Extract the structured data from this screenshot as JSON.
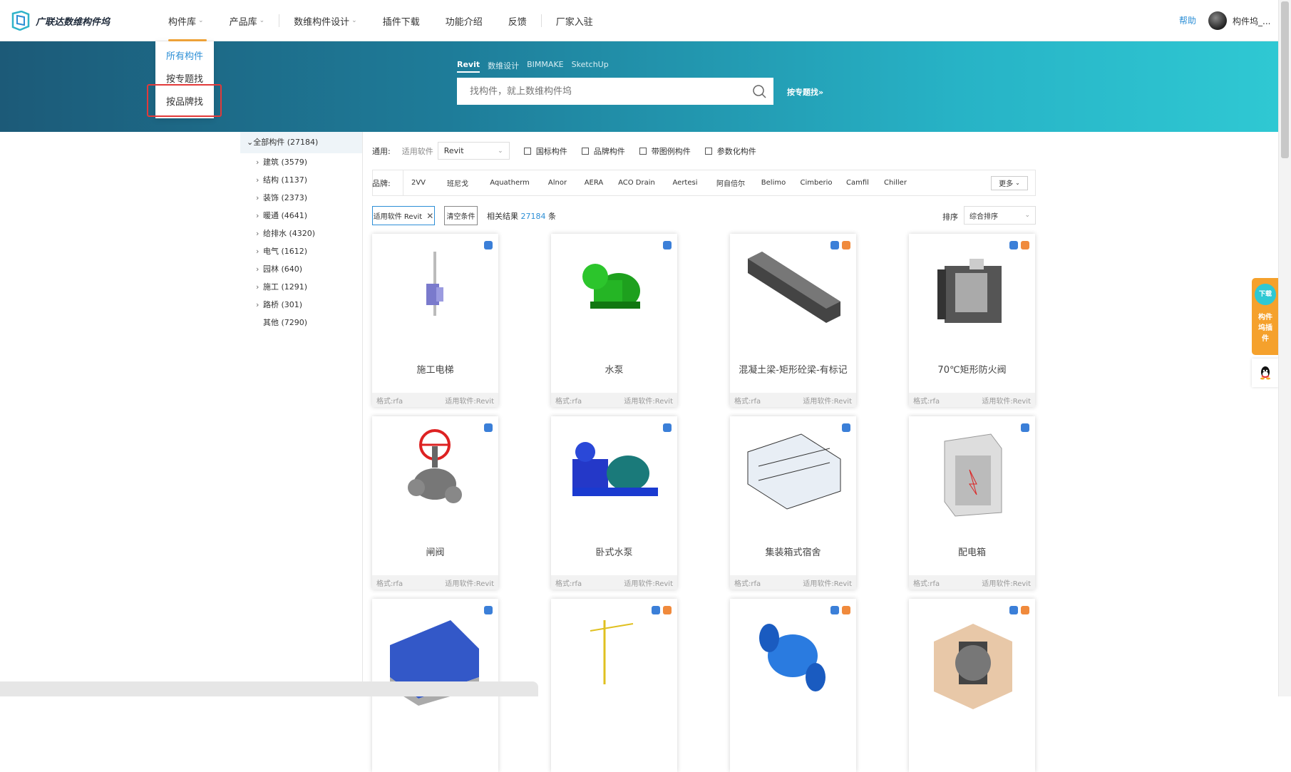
{
  "logo": {
    "text": "广联达数维构件坞"
  },
  "nav": [
    {
      "label": "构件库",
      "has_dropdown": true
    },
    {
      "label": "产品库",
      "has_dropdown": true
    },
    {
      "label": "数维构件设计",
      "has_dropdown": true
    },
    {
      "label": "插件下载",
      "has_dropdown": false
    },
    {
      "label": "功能介绍",
      "has_dropdown": false
    },
    {
      "label": "反馈",
      "has_dropdown": false
    },
    {
      "label": "厂家入驻",
      "has_dropdown": false
    }
  ],
  "header": {
    "help": "帮助",
    "username": "构件坞_..."
  },
  "dropdown": {
    "items": [
      "所有构件",
      "按专题找",
      "按品牌找"
    ],
    "selected": "所有构件",
    "highlighted": "按品牌找"
  },
  "search": {
    "tabs": [
      "Revit",
      "数维设计",
      "BIMMAKE",
      "SketchUp"
    ],
    "active_tab": "Revit",
    "placeholder": "找构件，就上数维构件坞",
    "topic_link": "按专题找»"
  },
  "sidebar": {
    "root": "全部构件 (27184)",
    "items": [
      {
        "label": "建筑 (3579)",
        "expandable": true
      },
      {
        "label": "结构 (1137)",
        "expandable": true
      },
      {
        "label": "装饰 (2373)",
        "expandable": true
      },
      {
        "label": "暖通 (4641)",
        "expandable": true
      },
      {
        "label": "给排水 (4320)",
        "expandable": true
      },
      {
        "label": "电气 (1612)",
        "expandable": true
      },
      {
        "label": "园林 (640)",
        "expandable": true
      },
      {
        "label": "施工 (1291)",
        "expandable": true
      },
      {
        "label": "路桥 (301)",
        "expandable": true
      },
      {
        "label": "其他 (7290)",
        "expandable": false
      }
    ]
  },
  "filters": {
    "general_label": "通用:",
    "software_label": "适用软件",
    "software_value": "Revit",
    "checkboxes": [
      "国标构件",
      "品牌构件",
      "带图例构件",
      "参数化构件"
    ],
    "brand_label": "品牌:",
    "brands": [
      "2VV",
      "班尼戈",
      "Aquatherm",
      "Alnor",
      "AERA",
      "ACO Drain",
      "Aertesi",
      "阿自倍尔",
      "Belimo",
      "Cimberio",
      "Camfil",
      "Chiller"
    ],
    "more": "更多"
  },
  "active_tag": "适用软件 Revit",
  "clear_label": "清空条件",
  "result": {
    "prefix": "相关结果",
    "count": "27184",
    "suffix": "条"
  },
  "sort": {
    "label": "排序",
    "value": "综合排序"
  },
  "cards": [
    {
      "name": "施工电梯",
      "format": "格式:rfa",
      "software": "适用软件:Revit",
      "badges": [
        "blue"
      ]
    },
    {
      "name": "水泵",
      "format": "格式:rfa",
      "software": "适用软件:Revit",
      "badges": [
        "blue"
      ]
    },
    {
      "name": "混凝土梁-矩形砼梁-有标记",
      "format": "格式:rfa",
      "software": "适用软件:Revit",
      "badges": [
        "blue",
        "orange"
      ]
    },
    {
      "name": "70℃矩形防火阀",
      "format": "格式:rfa",
      "software": "适用软件:Revit",
      "badges": [
        "blue",
        "orange"
      ]
    },
    {
      "name": "闸阀",
      "format": "格式:rfa",
      "software": "适用软件:Revit",
      "badges": [
        "blue"
      ]
    },
    {
      "name": "卧式水泵",
      "format": "格式:rfa",
      "software": "适用软件:Revit",
      "badges": [
        "blue"
      ]
    },
    {
      "name": "集装箱式宿舍",
      "format": "格式:rfa",
      "software": "适用软件:Revit",
      "badges": [
        "blue"
      ]
    },
    {
      "name": "配电箱",
      "format": "格式:rfa",
      "software": "适用软件:Revit",
      "badges": [
        "blue"
      ]
    },
    {
      "name": "",
      "format": "",
      "software": "",
      "badges": [
        "blue"
      ]
    },
    {
      "name": "",
      "format": "",
      "software": "",
      "badges": [
        "blue",
        "orange"
      ]
    },
    {
      "name": "",
      "format": "",
      "software": "",
      "badges": [
        "blue",
        "orange"
      ]
    },
    {
      "name": "",
      "format": "",
      "software": "",
      "badges": [
        "blue",
        "orange"
      ]
    }
  ],
  "float_plugin": {
    "download": "下载",
    "label": "构件坞插件"
  },
  "colors": {
    "accent": "#2d8fd6",
    "nav_underline": "#f4a63a",
    "banner_start": "#1c5a78",
    "banner_end": "#2fc8d3",
    "highlight_box": "#e23a3a",
    "plugin": "#f5a12c"
  }
}
